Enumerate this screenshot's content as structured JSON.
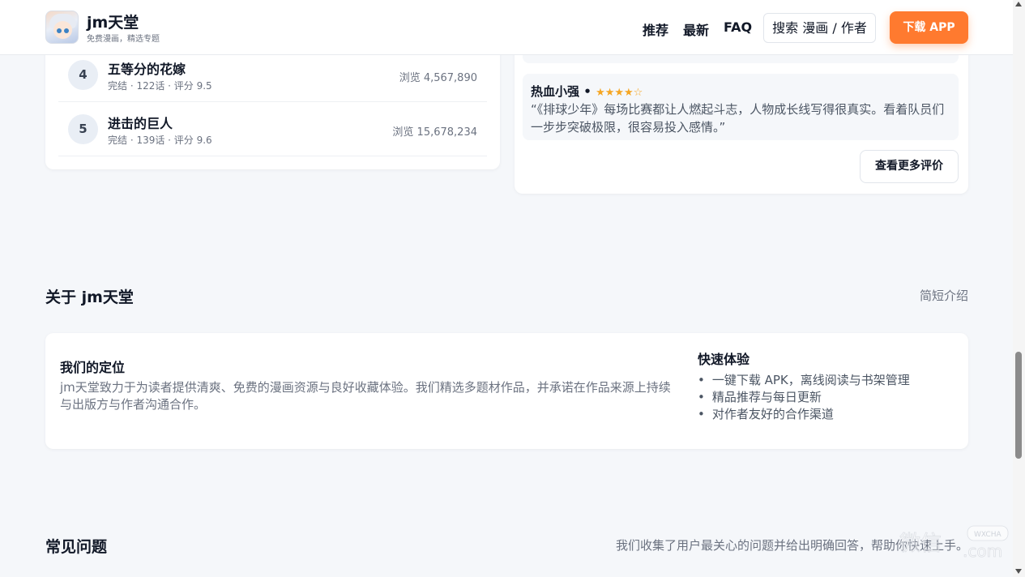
{
  "header": {
    "brand_title": "jm天堂",
    "brand_subtitle": "免费漫画，精选专题",
    "nav": [
      "推荐",
      "最新",
      "FAQ"
    ],
    "search_label": "搜索 漫画 / 作者",
    "download_label": "下载 APP",
    "accent_color": "#ff7a2f"
  },
  "ranking": {
    "items": [
      {
        "rank": "4",
        "title": "五等分的花嫁",
        "meta": "完结 · 122话 · 评分 9.5",
        "views": "浏览 4,567,890"
      },
      {
        "rank": "5",
        "title": "进击的巨人",
        "meta": "完结 · 139话 · 评分 9.6",
        "views": "浏览 15,678,234"
      }
    ]
  },
  "reviews": {
    "items": [
      {
        "user": "热血小强",
        "stars": "★★★★☆",
        "rating": 4,
        "text": "“《排球少年》每场比赛都让人燃起斗志，人物成长线写得很真实。看着队员们一步步突破极限，很容易投入感情。”"
      }
    ],
    "more_label": "查看更多评价"
  },
  "about": {
    "title": "关于 jm天堂",
    "note": "简短介绍",
    "heading": "我们的定位",
    "paragraph": "jm天堂致力于为读者提供清爽、免费的漫画资源与良好收藏体验。我们精选多题材作品，并承诺在作品来源上持续与出版方与作者沟通合作。",
    "quick_title": "快速体验",
    "quick_items": [
      "一键下载 APK，离线阅读与书架管理",
      "精品推荐与每日更新",
      "对作者友好的合作渠道"
    ]
  },
  "faq": {
    "title": "常见问题",
    "note": "我们收集了用户最关心的问题并给出明确回答，帮助你快速上手。"
  },
  "watermark": {
    "text": "微信",
    "badge": "WXCHA",
    "suffix": ".com"
  }
}
